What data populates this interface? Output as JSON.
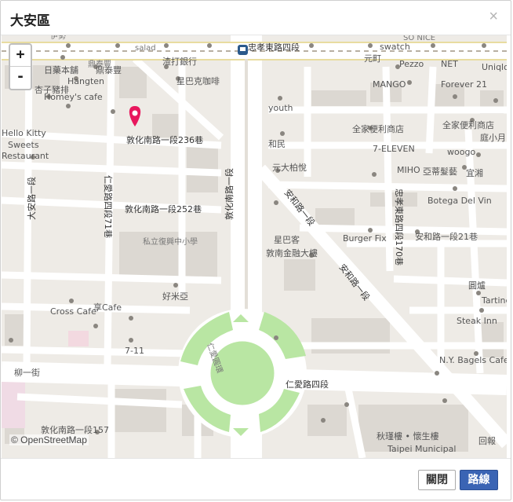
{
  "dialog": {
    "title": "大安區",
    "close_glyph": "×"
  },
  "map": {
    "zoom_in": "+",
    "zoom_out": "-",
    "attribution": "© OpenStreetMap",
    "marker_color": "#e8175d",
    "park_color": "#b9e6a3",
    "labels": {
      "zhongxiao_e_rd4": "忠孝東路四段",
      "dunhua_s_rd1_236": "敦化南路一段236巷",
      "dunhua_s_rd1_252": "敦化南路一段252巷",
      "dunhua_s_rd1": "敦化南路一段",
      "daan_rd1": "大安路一段",
      "ren_ai_rd4_71": "仁愛路四段71巷",
      "anhe_rd1": "安和路一段",
      "anhe_rd1_21": "安和路一段21巷",
      "zhongxiao_e_rd4_170": "忠孝東路四段170巷",
      "ren_ai_rd4": "仁愛路四段",
      "ren_ai_circle": "仁愛圓環",
      "fuxing_school": "私立復興中小學",
      "dunnan_building": "敦南金融大樓",
      "xingbake_2": "星巴客",
      "yuanjiyue": "元大柏悅",
      "liuyi_jie": "柳一街",
      "swatch": "swatch",
      "pezzo": "Pezzo",
      "net": "NET",
      "mango": "MANGO",
      "forever21": "Forever 21",
      "uniqlo": "Uniqlo",
      "youth": "youth",
      "family_mart_1": "全家便利商店",
      "family_mart_2": "全家便利商店",
      "he_min": "和民",
      "seven_eleven_1": "7-ELEVEN",
      "woogo": "woogo",
      "miho": "MIHO",
      "asia_hair": "亞蒂髮藝",
      "botega": "Botega Del Vin",
      "burger_fix": "Burger Fix",
      "tartine": "Tartine",
      "steak_inn": "Steak Inn",
      "ny_bagels": "N.Y. Bagels Cafe",
      "cross_cafe": "Cross Cafe",
      "hengxiang": "Hangten",
      "homeys": "Homey's cafe",
      "hello_kitty_1": "Hello Kitty",
      "hello_kitty_2": "Sweets",
      "hello_kitty_3": "Restaurant",
      "seven_eleven_2": "7-11",
      "haomi": "好米亞",
      "xingbake": "星巴克咖啡",
      "qiaoyu": "渣打銀行",
      "salad": "salad",
      "sonice": "SO NICE",
      "qiulun": "秋瑾樓 • 懷生樓",
      "taipei_muni": "Taipei Municipal",
      "huibao": "回報",
      "fuxing_157": "敦化南路一段157",
      "cake_shop": "杏子豬排",
      "ji_yu": "伊勢",
      "dong_qu": "日藥本舖",
      "kao_shui": "鼎泰豐",
      "yuanmen": "元町",
      "qingcha": "宜湘",
      "cafe_ren": "享Cafe",
      "renai_ya": "圓爐",
      "xiao_yue": "庭小月"
    }
  },
  "footer": {
    "close_label": "關閉",
    "route_label": "路線"
  }
}
